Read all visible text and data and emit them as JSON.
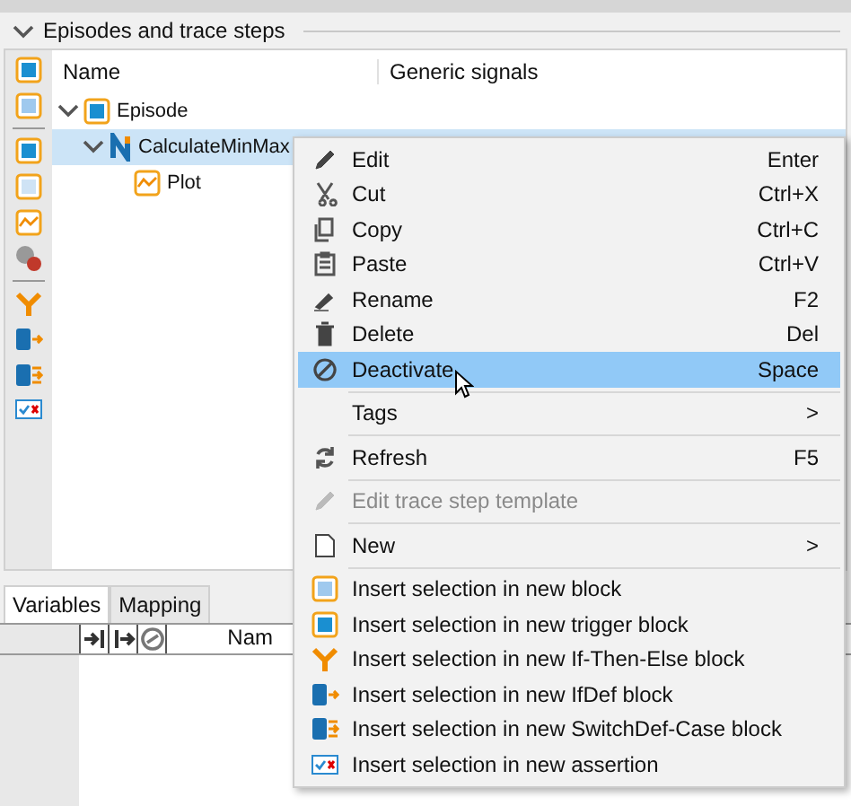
{
  "section": {
    "title": "Episodes and trace steps",
    "expanded": true
  },
  "tree": {
    "columns": [
      "Name",
      "Generic signals"
    ],
    "items": [
      {
        "label": "Episode",
        "expanded": true,
        "selected": false,
        "children": [
          {
            "label": "CalculateMinMax",
            "expanded": true,
            "selected": true,
            "children": [
              {
                "label": "Plot",
                "selected": false
              }
            ]
          }
        ]
      }
    ]
  },
  "bottom_tabs": [
    {
      "label": "Variables",
      "selected": true
    },
    {
      "label": "Mapping",
      "selected": false
    }
  ],
  "bottom_table": {
    "columns": [
      "Nam"
    ]
  },
  "context_menu": [
    {
      "label": "Edit",
      "shortcut": "Enter",
      "selected": false,
      "disabled": false,
      "separator_before": false
    },
    {
      "label": "Cut",
      "shortcut": "Ctrl+X",
      "selected": false,
      "disabled": false,
      "separator_before": false
    },
    {
      "label": "Copy",
      "shortcut": "Ctrl+C",
      "selected": false,
      "disabled": false,
      "separator_before": false
    },
    {
      "label": "Paste",
      "shortcut": "Ctrl+V",
      "selected": false,
      "disabled": false,
      "separator_before": false
    },
    {
      "label": "Rename",
      "shortcut": "F2",
      "selected": false,
      "disabled": false,
      "separator_before": false
    },
    {
      "label": "Delete",
      "shortcut": "Del",
      "selected": false,
      "disabled": false,
      "separator_before": false
    },
    {
      "label": "Deactivate",
      "shortcut": "Space",
      "selected": true,
      "disabled": false,
      "separator_before": false
    },
    {
      "label": "Tags",
      "submenu": ">",
      "selected": false,
      "disabled": false,
      "separator_before": true
    },
    {
      "label": "Refresh",
      "shortcut": "F5",
      "selected": false,
      "disabled": false,
      "separator_before": true
    },
    {
      "label": "Edit trace step template",
      "selected": false,
      "disabled": true,
      "separator_before": true
    },
    {
      "label": "New",
      "submenu": ">",
      "selected": false,
      "disabled": false,
      "separator_before": true
    },
    {
      "label": "Insert selection in new block",
      "selected": false,
      "disabled": false,
      "separator_before": true
    },
    {
      "label": "Insert selection in new trigger block",
      "selected": false,
      "disabled": false,
      "separator_before": false
    },
    {
      "label": "Insert selection in new If-Then-Else block",
      "selected": false,
      "disabled": false,
      "separator_before": false
    },
    {
      "label": "Insert selection in new IfDef block",
      "selected": false,
      "disabled": false,
      "separator_before": false
    },
    {
      "label": "Insert selection in new SwitchDef-Case block",
      "selected": false,
      "disabled": false,
      "separator_before": false
    },
    {
      "label": "Insert selection in new assertion",
      "selected": false,
      "disabled": false,
      "separator_before": false
    }
  ]
}
